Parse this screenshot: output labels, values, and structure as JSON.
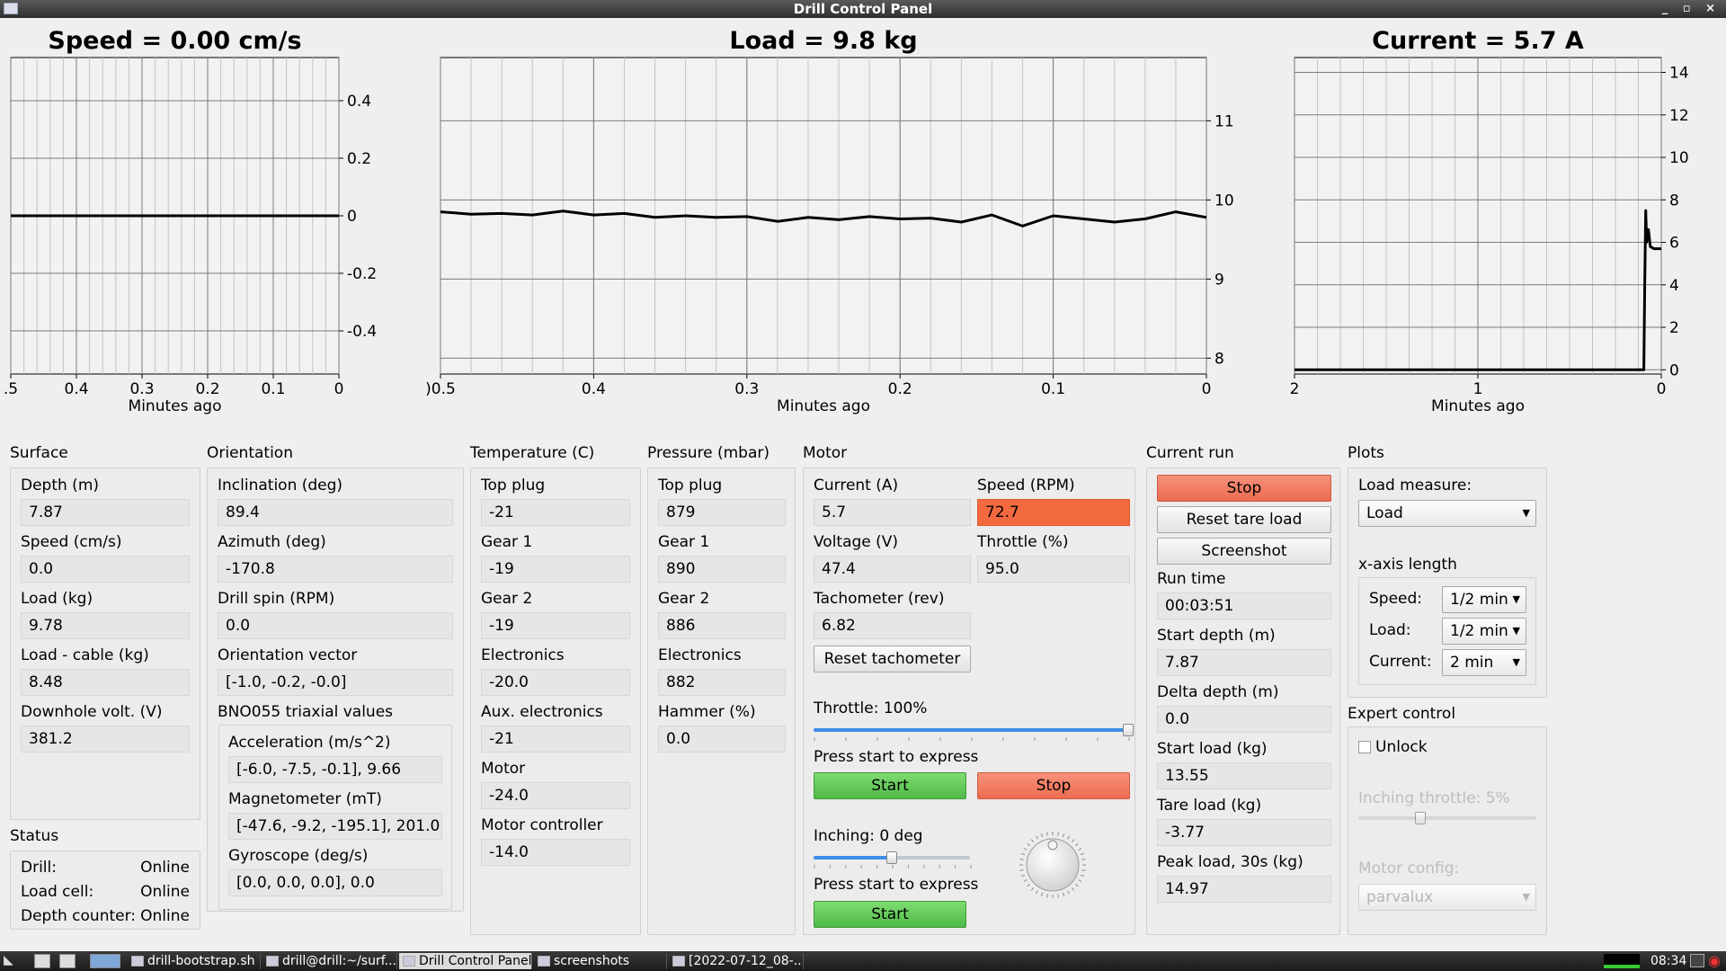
{
  "window": {
    "title": "Drill Control Panel",
    "controls": "_ ▫ ×"
  },
  "plots": {
    "speed": {
      "title": "Speed = 0.00 cm/s",
      "xlabel": "Minutes ago",
      "xticks": [
        ".5",
        "0.4",
        "0.3",
        "0.2",
        "0.1",
        "0"
      ],
      "yticks": [
        "0.4",
        "0.2",
        "0",
        "-0.2",
        "-0.4"
      ]
    },
    "load": {
      "title": "Load = 9.8 kg",
      "xlabel": "Minutes ago",
      "xticks": [
        ")0.5",
        "0.4",
        "0.3",
        "0.2",
        "0.1",
        "0"
      ],
      "yticks": [
        "11",
        "10",
        "9",
        "8"
      ]
    },
    "current": {
      "title": "Current = 5.7 A",
      "xlabel": "Minutes ago",
      "xticks": [
        "2",
        "1",
        "0"
      ],
      "yticks": [
        "14",
        "12",
        "10",
        "8",
        "6",
        "4",
        "2",
        "0"
      ]
    }
  },
  "chart_data": [
    {
      "type": "line",
      "title": "Speed = 0.00 cm/s",
      "xlabel": "Minutes ago",
      "xlim": [
        0.5,
        0
      ],
      "ylim": [
        -0.55,
        0.55
      ],
      "grid": true,
      "series": [
        {
          "x": [
            0.5,
            0.4,
            0.3,
            0.2,
            0.1,
            0
          ],
          "y": [
            0,
            0,
            0,
            0,
            0,
            0
          ]
        }
      ]
    },
    {
      "type": "line",
      "title": "Load = 9.8 kg",
      "xlabel": "Minutes ago",
      "xlim": [
        0.5,
        0
      ],
      "ylim": [
        7.8,
        11.8
      ],
      "grid": true,
      "series": [
        {
          "x": [
            0.5,
            0.48,
            0.46,
            0.44,
            0.42,
            0.4,
            0.38,
            0.36,
            0.34,
            0.32,
            0.3,
            0.28,
            0.26,
            0.24,
            0.22,
            0.2,
            0.18,
            0.16,
            0.14,
            0.12,
            0.1,
            0.08,
            0.06,
            0.04,
            0.02,
            0
          ],
          "y": [
            9.85,
            9.82,
            9.83,
            9.81,
            9.86,
            9.81,
            9.83,
            9.78,
            9.8,
            9.78,
            9.79,
            9.73,
            9.78,
            9.75,
            9.79,
            9.76,
            9.77,
            9.72,
            9.81,
            9.67,
            9.8,
            9.76,
            9.72,
            9.76,
            9.85,
            9.78
          ]
        }
      ]
    },
    {
      "type": "line",
      "title": "Current = 5.7 A",
      "xlabel": "Minutes ago",
      "xlim": [
        2,
        0
      ],
      "ylim": [
        -0.2,
        14.7
      ],
      "grid": true,
      "series": [
        {
          "x": [
            2,
            1.5,
            1,
            0.5,
            0.1,
            0.095,
            0.09,
            0.085,
            0.08,
            0.07,
            0.06,
            0.04,
            0.02,
            0
          ],
          "y": [
            0,
            0,
            0,
            0,
            0,
            0,
            4,
            7.5,
            6,
            6.6,
            5.8,
            5.7,
            5.7,
            5.7
          ]
        }
      ]
    }
  ],
  "surface": {
    "title": "Surface",
    "fields": [
      {
        "label": "Depth (m)",
        "value": "7.87"
      },
      {
        "label": "Speed (cm/s)",
        "value": "0.0"
      },
      {
        "label": "Load (kg)",
        "value": "9.78"
      },
      {
        "label": "Load - cable (kg)",
        "value": "8.48"
      },
      {
        "label": "Downhole volt. (V)",
        "value": "381.2"
      }
    ]
  },
  "status": {
    "title": "Status",
    "rows": [
      {
        "label": "Drill:",
        "value": "Online"
      },
      {
        "label": "Load cell:",
        "value": "Online"
      },
      {
        "label": "Depth counter:",
        "value": "Online"
      }
    ]
  },
  "orientation": {
    "title": "Orientation",
    "fields": [
      {
        "label": "Inclination (deg)",
        "value": "89.4"
      },
      {
        "label": "Azimuth (deg)",
        "value": "-170.8"
      },
      {
        "label": "Drill spin (RPM)",
        "value": "0.0"
      },
      {
        "label": "Orientation vector",
        "value": "[-1.0, -0.2, -0.0]"
      }
    ],
    "bno_title": "BNO055 triaxial values",
    "bno": [
      {
        "label": "Acceleration (m/s^2)",
        "value": "[-6.0, -7.5, -0.1], 9.66"
      },
      {
        "label": "Magnetometer (mT)",
        "value": "[-47.6, -9.2, -195.1], 201.0"
      },
      {
        "label": "Gyroscope (deg/s)",
        "value": "[0.0, 0.0, 0.0], 0.0"
      }
    ]
  },
  "temperature": {
    "title": "Temperature (C)",
    "fields": [
      {
        "label": "Top plug",
        "value": "-21"
      },
      {
        "label": "Gear 1",
        "value": "-19"
      },
      {
        "label": "Gear 2",
        "value": "-19"
      },
      {
        "label": "Electronics",
        "value": "-20.0"
      },
      {
        "label": "Aux. electronics",
        "value": "-21"
      },
      {
        "label": "Motor",
        "value": "-24.0"
      },
      {
        "label": "Motor controller",
        "value": "-14.0"
      }
    ]
  },
  "pressure": {
    "title": "Pressure (mbar)",
    "fields": [
      {
        "label": "Top plug",
        "value": "879"
      },
      {
        "label": "Gear 1",
        "value": "890"
      },
      {
        "label": "Gear 2",
        "value": "886"
      },
      {
        "label": "Electronics",
        "value": "882"
      },
      {
        "label": "Hammer (%)",
        "value": "0.0"
      }
    ]
  },
  "motor": {
    "title": "Motor",
    "current_label": "Current (A)",
    "current": "5.7",
    "speed_label": "Speed (RPM)",
    "speed": "72.7",
    "voltage_label": "Voltage (V)",
    "voltage": "47.4",
    "throttle_label": "Throttle (%)",
    "throttle": "95.0",
    "tacho_label": "Tachometer (rev)",
    "tacho": "6.82",
    "reset_tacho": "Reset tachometer",
    "throttle_slider_label": "Throttle: 100%",
    "throttle_level": 1.0,
    "express1": "Press start to express",
    "start": "Start",
    "stop": "Stop",
    "inching_label": "Inching: 0 deg",
    "inching_level": 0.5,
    "express2": "Press start to express",
    "start2": "Start",
    "alert_color": "#f46a40"
  },
  "current_run": {
    "title": "Current run",
    "stop": "Stop",
    "reset_tare": "Reset tare load",
    "screenshot": "Screenshot",
    "fields": [
      {
        "label": "Run time",
        "value": "00:03:51"
      },
      {
        "label": "Start depth (m)",
        "value": "7.87"
      },
      {
        "label": "Delta depth (m)",
        "value": "0.0"
      },
      {
        "label": "Start load (kg)",
        "value": "13.55"
      },
      {
        "label": "Tare load (kg)",
        "value": "-3.77"
      },
      {
        "label": "Peak load, 30s (kg)",
        "value": "14.97"
      }
    ]
  },
  "plots_panel": {
    "title": "Plots",
    "load_measure_label": "Load measure:",
    "load_measure": "Load",
    "xaxis_label": "x-axis length",
    "speed_label": "Speed:",
    "speed_val": "1/2 min",
    "load_label": "Load:",
    "load_val": "1/2 min",
    "current_label": "Current:",
    "current_val": "2 min"
  },
  "expert": {
    "title": "Expert control",
    "unlock": "Unlock",
    "inching_throttle": "Inching throttle: 5%",
    "inching_throttle_level": 0.35,
    "motor_config_label": "Motor config:",
    "motor_config": "parvalux"
  },
  "taskbar": {
    "items": [
      "drill-bootstrap.sh",
      "drill@drill:~/surf...",
      "Drill Control Panel",
      "screenshots",
      "[2022-07-12_08-..."
    ],
    "clock": "08:34"
  }
}
